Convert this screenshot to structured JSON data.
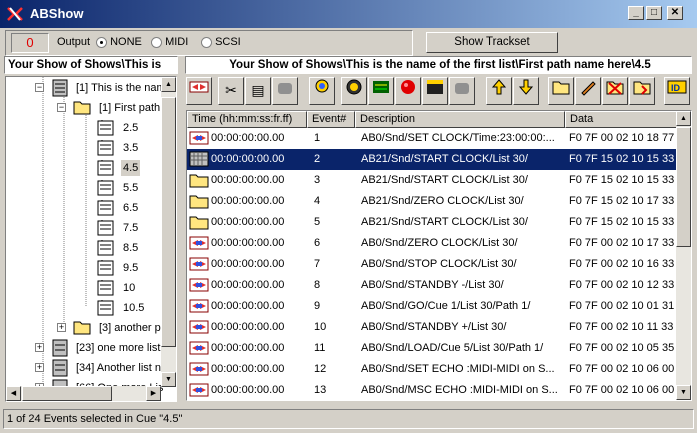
{
  "window": {
    "title": "ABShow",
    "minimize": "_",
    "maximize": "□",
    "close": "✕"
  },
  "toolbar": {
    "counter": "0",
    "output_label": "Output",
    "options": [
      "NONE",
      "MIDI",
      "SCSI"
    ],
    "selected": "NONE",
    "show_trackset": "Show Trackset"
  },
  "paths": {
    "left": "Your Show of Shows\\This is",
    "right": "Your Show of Shows\\This is the name of the first list\\First path name here\\4.5"
  },
  "tree": {
    "list1": "[1] This is the nam",
    "path1": "[1] First path",
    "cues": [
      "2.5",
      "3.5",
      "4.5",
      "5.5",
      "6.5",
      "7.5",
      "8.5",
      "9.5",
      "10",
      "10.5"
    ],
    "selected_cue": "4.5",
    "path3": "[3] another p",
    "list23": "[23] one more list",
    "list34": "[34] Another list n",
    "list66": "[66] One more Lis"
  },
  "grid": {
    "headers": [
      "Time (hh:mm:ss:fr.ff)",
      "Event#",
      "Description",
      "Data"
    ],
    "rows": [
      {
        "time": "00:00:00:00.00",
        "event": "1",
        "desc": "AB0/Snd/SET CLOCK/Time:23:00:00:...",
        "data": "F0 7F 00 02 10 18 77 0",
        "icon": "midi"
      },
      {
        "time": "00:00:00:00.00",
        "event": "2",
        "desc": "AB21/Snd/START CLOCK/List 30/",
        "data": "F0 7F 15 02 10 15 33 3",
        "icon": "grid"
      },
      {
        "time": "00:00:00:00.00",
        "event": "3",
        "desc": "AB21/Snd/START CLOCK/List 30/",
        "data": "F0 7F 15 02 10 15 33 3",
        "icon": "folder"
      },
      {
        "time": "00:00:00:00.00",
        "event": "4",
        "desc": "AB21/Snd/ZERO CLOCK/List 30/",
        "data": "F0 7F 15 02 10 17 33 3",
        "icon": "folder"
      },
      {
        "time": "00:00:00:00.00",
        "event": "5",
        "desc": "AB21/Snd/START CLOCK/List 30/",
        "data": "F0 7F 15 02 10 15 33 3",
        "icon": "folder"
      },
      {
        "time": "00:00:00:00.00",
        "event": "6",
        "desc": "AB0/Snd/ZERO CLOCK/List 30/",
        "data": "F0 7F 00 02 10 17 33 3",
        "icon": "midi"
      },
      {
        "time": "00:00:00:00.00",
        "event": "7",
        "desc": "AB0/Snd/STOP CLOCK/List 30/",
        "data": "F0 7F 00 02 10 16 33 3",
        "icon": "midi"
      },
      {
        "time": "00:00:00:00.00",
        "event": "8",
        "desc": "AB0/Snd/STANDBY -/List 30/",
        "data": "F0 7F 00 02 10 12 33 3",
        "icon": "midi"
      },
      {
        "time": "00:00:00:00.00",
        "event": "9",
        "desc": "AB0/Snd/GO/Cue 1/List 30/Path 1/",
        "data": "F0 7F 00 02 10 01 31 0",
        "icon": "midi"
      },
      {
        "time": "00:00:00:00.00",
        "event": "10",
        "desc": "AB0/Snd/STANDBY +/List 30/",
        "data": "F0 7F 00 02 10 11 33 3",
        "icon": "midi"
      },
      {
        "time": "00:00:00:00.00",
        "event": "11",
        "desc": "AB0/Snd/LOAD/Cue 5/List 30/Path 1/",
        "data": "F0 7F 00 02 10 05 35 0",
        "icon": "midi"
      },
      {
        "time": "00:00:00:00.00",
        "event": "12",
        "desc": "AB0/Snd/SET ECHO :MIDI-MIDI on S...",
        "data": "F0 7F 00 02 10 06 00 0",
        "icon": "midi"
      },
      {
        "time": "00:00:00:00.00",
        "event": "13",
        "desc": "AB0/Snd/MSC ECHO :MIDI-MIDI on S...",
        "data": "F0 7F 00 02 10 06 00 0",
        "icon": "midi"
      }
    ],
    "selected_event": "2"
  },
  "status": "1 of 24 Events selected in Cue \"4.5\""
}
